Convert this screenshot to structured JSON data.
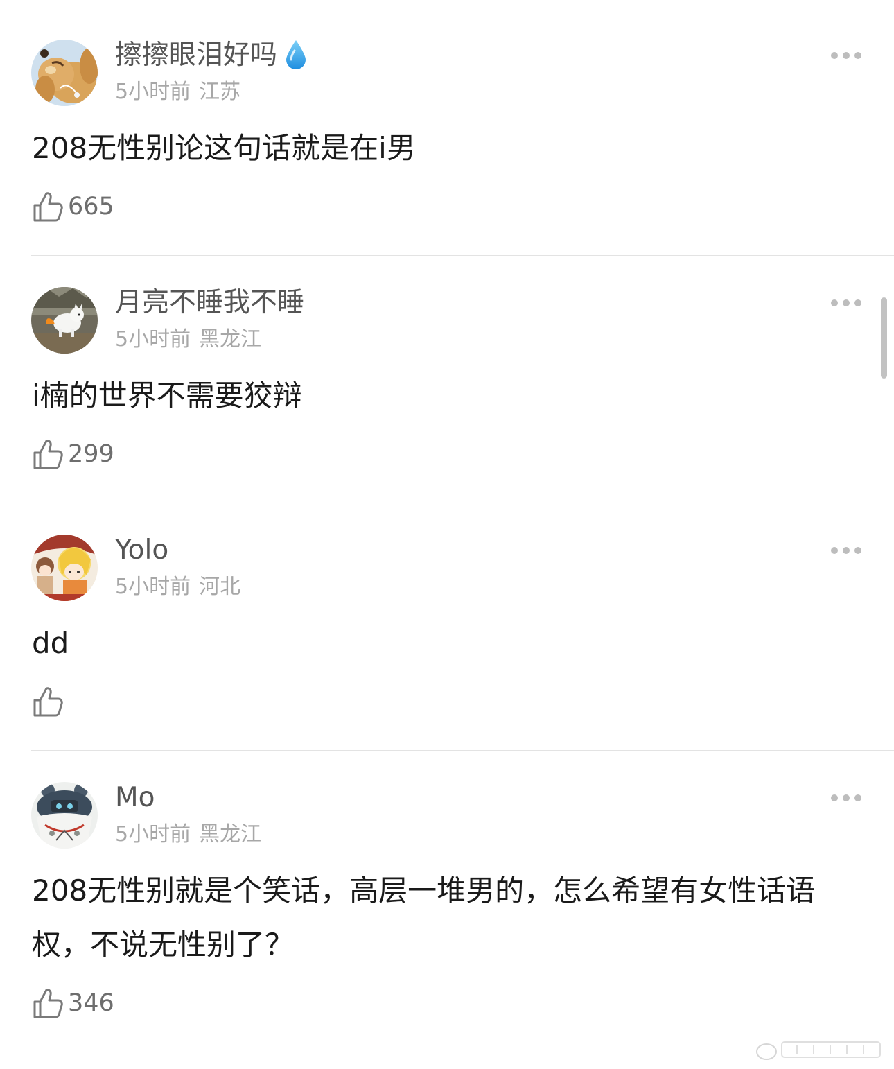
{
  "comments": [
    {
      "username": "擦擦眼泪好吗",
      "badge_icon": "water-drop-icon",
      "time": "5小时前",
      "location": "江苏",
      "text": "208无性别论这句话就是在i男",
      "likes": "665",
      "avatar": "dog-with-headphones"
    },
    {
      "username": "月亮不睡我不睡",
      "time": "5小时前",
      "location": "黑龙江",
      "text": "i楠的世界不需要狡辩",
      "likes": "299",
      "avatar": "white-dog-outdoors"
    },
    {
      "username": "Yolo",
      "time": "5小时前",
      "location": "河北",
      "text": "dd",
      "likes": "",
      "avatar": "anime-characters"
    },
    {
      "username": "Mo",
      "time": "5小时前",
      "location": "黑龙江",
      "text": "208无性别就是个笑话，高层一堆男的，怎么希望有女性话语权，不说无性别了？",
      "likes": "346",
      "avatar": "anime-mascot"
    }
  ],
  "icons": {
    "like": "thumbs-up-icon",
    "more": "more-options-icon"
  },
  "colors": {
    "text": "#1a1a1a",
    "username": "#555555",
    "meta": "#a7a7a7",
    "divider": "#e3e3e3"
  }
}
